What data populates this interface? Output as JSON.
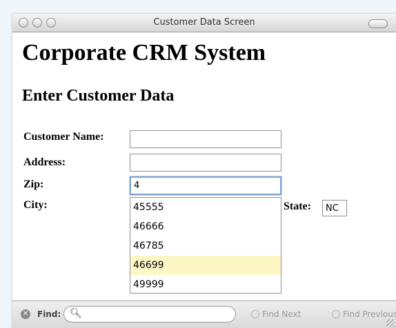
{
  "window": {
    "title": "Customer Data Screen"
  },
  "page": {
    "heading": "Corporate CRM System",
    "subheading": "Enter Customer Data"
  },
  "form": {
    "customer_name_label": "Customer Name:",
    "customer_name_value": "",
    "address_label": "Address:",
    "address_value": "",
    "zip_label": "Zip:",
    "zip_value": "4",
    "city_label": "City:",
    "state_label": "State:",
    "state_value": "NC"
  },
  "autocomplete": {
    "items": [
      "45555",
      "46666",
      "46785",
      "46699",
      "49999"
    ],
    "highlighted": "46699"
  },
  "findbar": {
    "label": "Find:",
    "value": "",
    "next_label": "Find Next",
    "prev_label": "Find Previous"
  },
  "colors": {
    "highlight": "#fdf7c6",
    "focus_ring": "#7fa6cf",
    "background": "#eef6fb"
  }
}
